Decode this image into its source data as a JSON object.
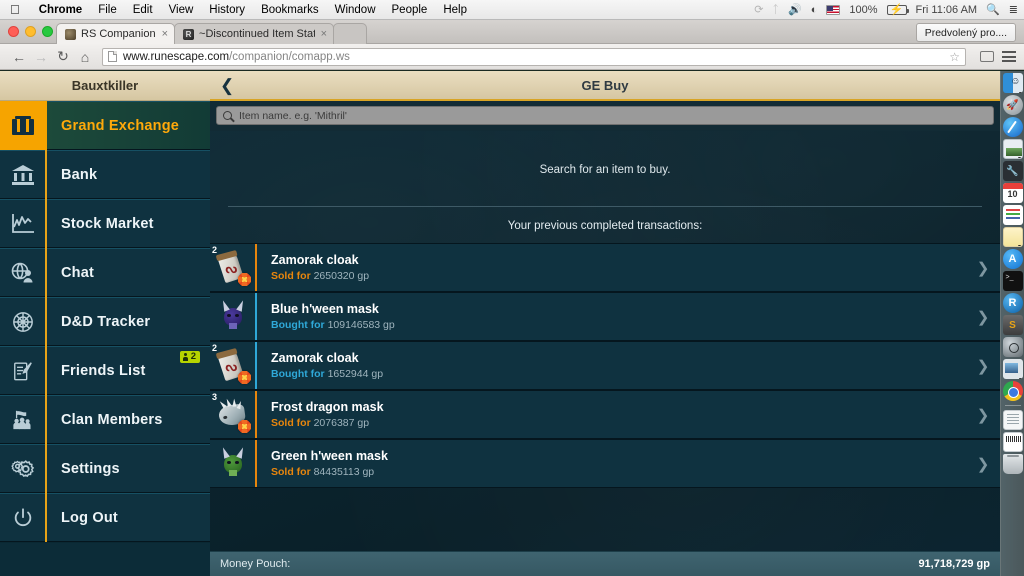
{
  "menubar": {
    "apple_icon": "apple-logo",
    "items": [
      "Chrome",
      "File",
      "Edit",
      "View",
      "History",
      "Bookmarks",
      "Window",
      "People",
      "Help"
    ],
    "status": {
      "timemachine_icon": "time-machine-icon",
      "bluetooth_icon": "bluetooth-icon",
      "volume_icon": "volume-icon",
      "wifi_icon": "wifi-icon",
      "input_flag": "us-flag-icon",
      "battery_percent": "100%",
      "battery_icon": "battery-icon",
      "clock": "Fri 11:06 AM",
      "spotlight_icon": "search-icon",
      "notifications_icon": "list-icon"
    }
  },
  "browser": {
    "tabs": [
      {
        "title": "RS Companion",
        "active": true,
        "close": "×"
      },
      {
        "title": "~Discontinued Item Status",
        "active": false,
        "close": "×"
      }
    ],
    "profile_button": "Predvolený pro....",
    "nav": {
      "back": "←",
      "forward": "→",
      "reload": "C",
      "home": "⌂"
    },
    "url_host": "www.runescape.com",
    "url_path": "/companion/comapp.ws",
    "bookmark_star": "☆",
    "cast_icon": "cast-icon",
    "menu_icon": "hamburger-menu-icon"
  },
  "sidebar": {
    "username": "Bauxtkiller",
    "items": [
      {
        "label": "Grand Exchange",
        "icon": "grand-exchange-icon",
        "active": true,
        "badge": null
      },
      {
        "label": "Bank",
        "icon": "bank-icon",
        "active": false,
        "badge": null
      },
      {
        "label": "Stock Market",
        "icon": "chart-icon",
        "active": false,
        "badge": null
      },
      {
        "label": "Chat",
        "icon": "chat-globe-icon",
        "active": false,
        "badge": null
      },
      {
        "label": "D&D Tracker",
        "icon": "compass-icon",
        "active": false,
        "badge": null
      },
      {
        "label": "Friends List",
        "icon": "notepad-pen-icon",
        "active": false,
        "badge": "2"
      },
      {
        "label": "Clan Members",
        "icon": "people-flag-icon",
        "active": false,
        "badge": null
      },
      {
        "label": "Settings",
        "icon": "gears-icon",
        "active": false,
        "badge": null
      },
      {
        "label": "Log Out",
        "icon": "power-icon",
        "active": false,
        "badge": null
      }
    ]
  },
  "page": {
    "back_icon": "chevron-left-icon",
    "title": "GE Buy",
    "search_placeholder": "Item name. e.g. 'Mithril'",
    "search_value": "",
    "search_icon": "search-icon",
    "hint": "Search for an item to buy.",
    "transactions_heading": "Your previous completed transactions:",
    "transactions": [
      {
        "name": "Zamorak cloak",
        "qty": "2",
        "action": "Sold for",
        "type": "sold",
        "amount": "2650320 gp",
        "sprite": "cloak",
        "chevron": "chevron-right-icon"
      },
      {
        "name": "Blue h'ween mask",
        "qty": "",
        "action": "Bought for",
        "type": "bought",
        "amount": "109146583 gp",
        "sprite": "mask-blue",
        "chevron": "chevron-right-icon"
      },
      {
        "name": "Zamorak cloak",
        "qty": "2",
        "action": "Bought for",
        "type": "bought",
        "amount": "1652944 gp",
        "sprite": "cloak",
        "chevron": "chevron-right-icon"
      },
      {
        "name": "Frost dragon mask",
        "qty": "3",
        "action": "Sold for",
        "type": "sold",
        "amount": "2076387 gp",
        "sprite": "dragon",
        "chevron": "chevron-right-icon"
      },
      {
        "name": "Green h'ween mask",
        "qty": "",
        "action": "Sold for",
        "type": "sold",
        "amount": "84435113 gp",
        "sprite": "mask-green",
        "chevron": "chevron-right-icon"
      }
    ],
    "money_pouch_label": "Money Pouch:",
    "money_pouch_value": "91,718,729 gp"
  },
  "dock": {
    "items": [
      {
        "icon": "finder-icon",
        "running": true
      },
      {
        "icon": "launchpad-icon",
        "running": false
      },
      {
        "icon": "safari-icon",
        "running": true
      },
      {
        "icon": "photos-icon",
        "running": true
      },
      {
        "icon": "xcode-icon",
        "running": true
      },
      {
        "icon": "calendar-icon",
        "running": false
      },
      {
        "icon": "reminders-icon",
        "running": false
      },
      {
        "icon": "notes-icon",
        "running": true
      },
      {
        "icon": "app-store-icon",
        "running": false
      },
      {
        "icon": "terminal-icon",
        "running": false
      },
      {
        "icon": "runescape-icon",
        "running": false
      },
      {
        "icon": "sublime-icon",
        "running": false
      },
      {
        "icon": "disk-utility-icon",
        "running": false
      },
      {
        "icon": "preview-icon",
        "running": true
      },
      {
        "icon": "chrome-icon",
        "running": true
      },
      {
        "icon": "document-icon",
        "running": false
      },
      {
        "icon": "scanner-icon",
        "running": false
      },
      {
        "icon": "trash-icon",
        "running": false
      }
    ]
  },
  "colors": {
    "accent_orange": "#f6a400",
    "sold": "#e8860d",
    "bought": "#2fa8d8",
    "badge": "#b6d400",
    "panel": "#0f3240",
    "parchment": "#e3d3ac"
  }
}
